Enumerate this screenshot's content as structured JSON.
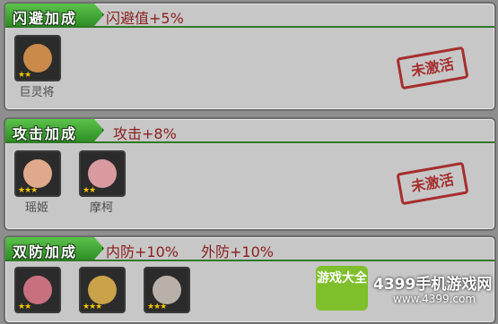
{
  "sections": [
    {
      "title": "闪避加成",
      "bonuses": [
        "闪避值+5%"
      ],
      "heroes": [
        {
          "name": "巨灵将",
          "stars": 2,
          "color": "#c98a4a"
        }
      ],
      "status": "未激活"
    },
    {
      "title": "攻击加成",
      "bonuses": [
        "攻击+8%"
      ],
      "heroes": [
        {
          "name": "瑶姬",
          "stars": 3,
          "color": "#e0a98c"
        },
        {
          "name": "摩柯",
          "stars": 2,
          "color": "#d99aa0"
        }
      ],
      "status": "未激活"
    },
    {
      "title": "双防加成",
      "bonuses": [
        "内防+10%",
        "外防+10%"
      ],
      "heroes": [
        {
          "name": "",
          "stars": 2,
          "color": "#c9707f"
        },
        {
          "name": "",
          "stars": 3,
          "color": "#c9a24a"
        },
        {
          "name": "",
          "stars": 3,
          "color": "#b8b0a8"
        }
      ],
      "status": ""
    }
  ],
  "watermark": {
    "logo": "游戏大全",
    "site": "4399手机游戏网",
    "url": "www.4399.com"
  }
}
